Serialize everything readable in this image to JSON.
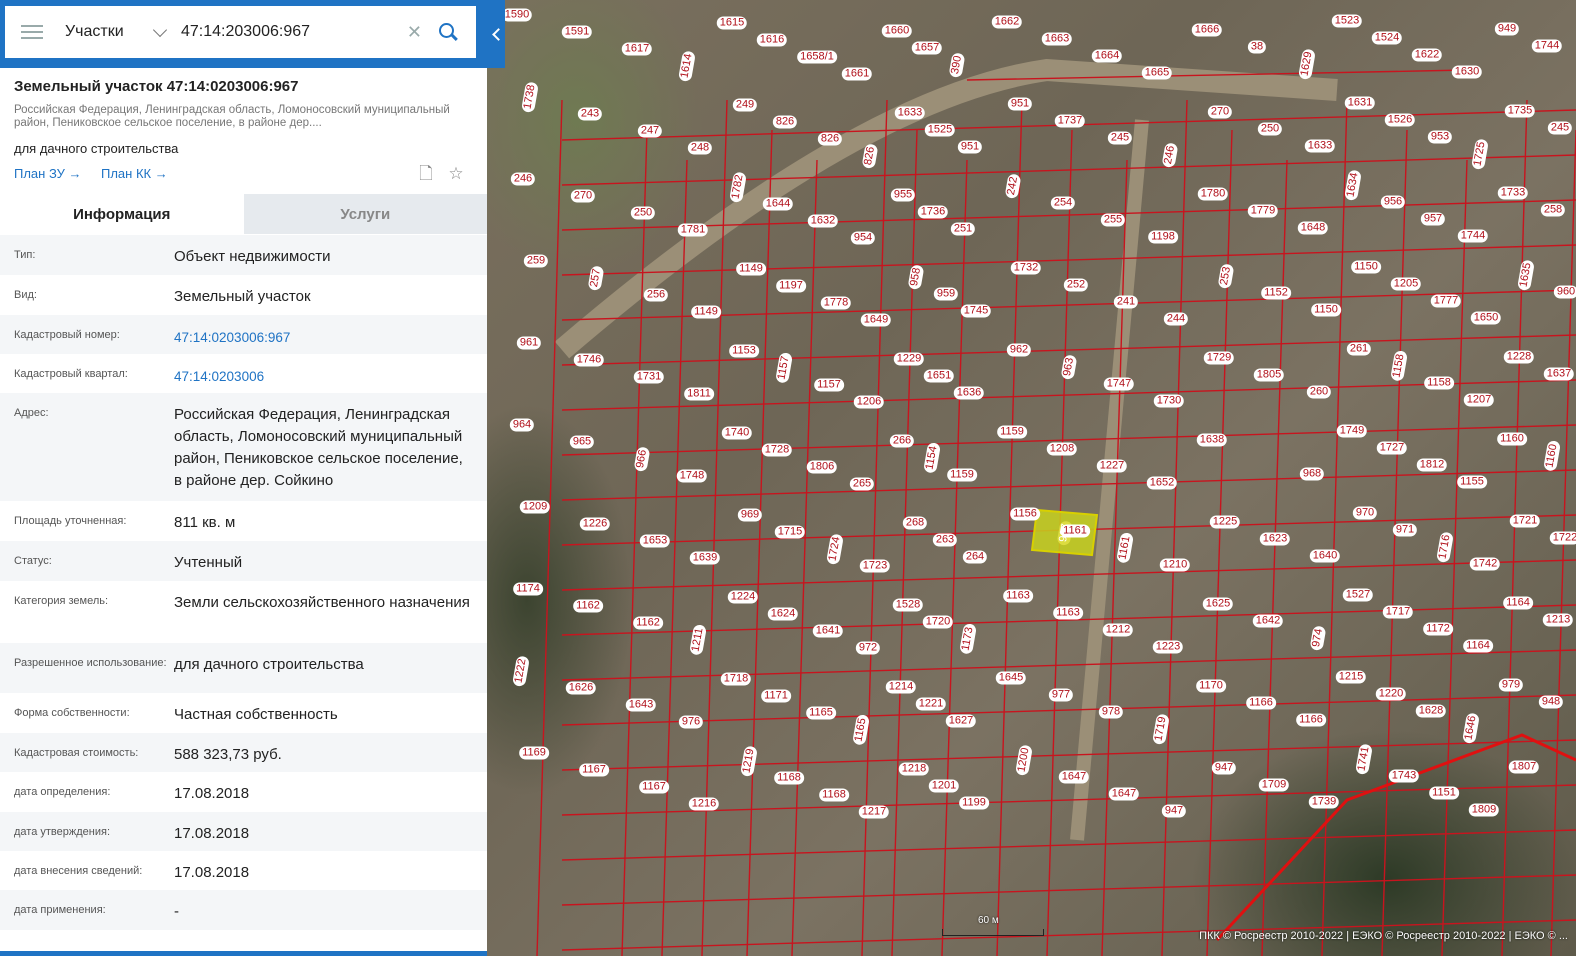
{
  "search": {
    "layer": "Участки",
    "value": "47:14:203006:967"
  },
  "card": {
    "title": "Земельный участок 47:14:0203006:967",
    "address_short": "Российская Федерация, Ленинградская область, Ломоносовский муниципальный район, Пениковское сельское поселение, в районе дер....",
    "use": "для дачного строительства",
    "link_plan_zu": "План ЗУ",
    "link_plan_kk": "План КК"
  },
  "tabs": {
    "info": "Информация",
    "services": "Услуги"
  },
  "info": [
    {
      "k": "Тип:",
      "v": "Объект недвижимости"
    },
    {
      "k": "Вид:",
      "v": "Земельный участок"
    },
    {
      "k": "Кадастровый номер:",
      "v": "47:14:0203006:967"
    },
    {
      "k": "Кадастровый квартал:",
      "v": "47:14:0203006"
    },
    {
      "k": "Адрес:",
      "v": "Российская Федерация, Ленинградская область, Ломоносовский муниципальный район, Пениковское сельское поселение, в районе дер. Сойкино"
    },
    {
      "k": "Площадь уточненная:",
      "v": "811 кв. м"
    },
    {
      "k": "Статус:",
      "v": "Учтенный"
    },
    {
      "k": "Категория земель:",
      "v": "Земли сельскохозяйственного назначения"
    },
    {
      "k": "Разрешенное использование:",
      "v": "для дачного строительства"
    },
    {
      "k": "Форма собственности:",
      "v": "Частная собственность"
    },
    {
      "k": "Кадастровая стоимость:",
      "v": "588 323,73 руб."
    },
    {
      "k": "дата определения:",
      "v": "17.08.2018"
    },
    {
      "k": "дата утверждения:",
      "v": "17.08.2018"
    },
    {
      "k": "дата внесения сведений:",
      "v": "17.08.2018"
    },
    {
      "k": "дата применения:",
      "v": "-"
    }
  ],
  "map": {
    "selected_parcel": "967",
    "scale": "60 м",
    "copyright": "ПКК © Росреестр 2010-2022 | ЕЭКО © Росреестр 2010-2022 | ЕЭКО © ...",
    "labels": [
      "1590",
      "1591",
      "1617",
      "1614",
      "1615",
      "1616",
      "1658/1",
      "1661",
      "1660",
      "1657",
      "390",
      "1662",
      "1663",
      "1664",
      "1665",
      "1666",
      "38",
      "1629",
      "1523",
      "1524",
      "1622",
      "1630",
      "949",
      "1744",
      "1738",
      "243",
      "247",
      "248",
      "249",
      "826",
      "826",
      "826",
      "1633",
      "1525",
      "951",
      "951",
      "1737",
      "245",
      "246",
      "270",
      "250",
      "1633",
      "1631",
      "1526",
      "953",
      "1725",
      "1735",
      "245",
      "246",
      "270",
      "250",
      "1781",
      "1782",
      "1644",
      "1632",
      "954",
      "955",
      "1736",
      "251",
      "242",
      "254",
      "255",
      "1198",
      "1780",
      "1779",
      "1648",
      "1634",
      "956",
      "957",
      "1744",
      "1733",
      "258",
      "259",
      "257",
      "256",
      "1149",
      "1149",
      "1197",
      "1778",
      "1649",
      "958",
      "959",
      "1745",
      "1732",
      "252",
      "241",
      "244",
      "253",
      "1152",
      "1150",
      "1150",
      "1205",
      "1777",
      "1650",
      "1635",
      "960",
      "961",
      "1746",
      "1731",
      "1811",
      "1153",
      "1157",
      "1157",
      "1206",
      "1229",
      "1651",
      "1636",
      "962",
      "963",
      "1747",
      "1730",
      "1729",
      "1805",
      "260",
      "261",
      "1158",
      "1158",
      "1207",
      "1228",
      "1637",
      "964",
      "965",
      "966",
      "1748",
      "1740",
      "1728",
      "1806",
      "265",
      "266",
      "1154",
      "1159",
      "1159",
      "1208",
      "1227",
      "1652",
      "1638",
      "967",
      "968",
      "1749",
      "1727",
      "1812",
      "1155",
      "1160",
      "1160",
      "1209",
      "1226",
      "1653",
      "1639",
      "969",
      "1715",
      "1724",
      "1723",
      "268",
      "263",
      "264",
      "1156",
      "1161",
      "1161",
      "1210",
      "1225",
      "1623",
      "1640",
      "970",
      "971",
      "1716",
      "1742",
      "1721",
      "1722",
      "1174",
      "1162",
      "1162",
      "1211",
      "1224",
      "1624",
      "1641",
      "972",
      "1528",
      "1720",
      "1173",
      "1163",
      "1163",
      "1212",
      "1223",
      "1625",
      "1642",
      "974",
      "1527",
      "1717",
      "1172",
      "1164",
      "1164",
      "1213",
      "1222",
      "1626",
      "1643",
      "976",
      "1718",
      "1171",
      "1165",
      "1165",
      "1214",
      "1221",
      "1627",
      "1645",
      "977",
      "978",
      "1719",
      "1170",
      "1166",
      "1166",
      "1215",
      "1220",
      "1628",
      "1646",
      "979",
      "948",
      "1169",
      "1167",
      "1167",
      "1216",
      "1219",
      "1168",
      "1168",
      "1217",
      "1218",
      "1201",
      "1199",
      "1200",
      "1647",
      "1647",
      "947",
      "947",
      "1709",
      "1739",
      "1741",
      "1743",
      "1151",
      "1809",
      "1807"
    ]
  }
}
